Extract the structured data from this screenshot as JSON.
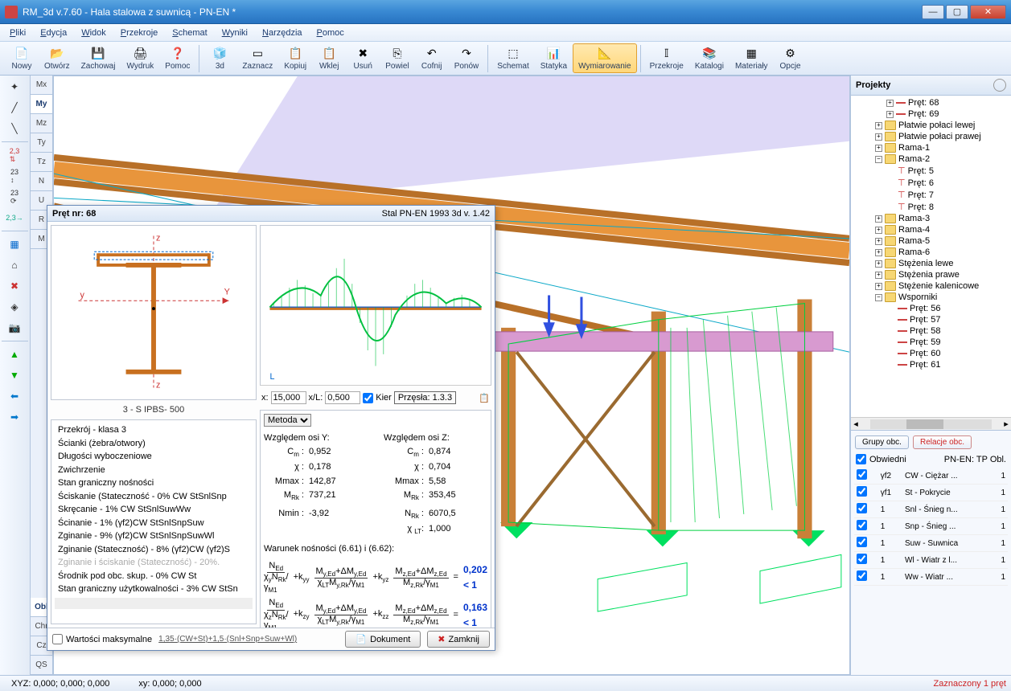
{
  "window": {
    "title": "RM_3d v.7.60 - Hala stalowa z suwnicą - PN-EN *"
  },
  "menu": [
    "Pliki",
    "Edycja",
    "Widok",
    "Przekroje",
    "Schemat",
    "Wyniki",
    "Narzędzia",
    "Pomoc"
  ],
  "toolbar": [
    {
      "label": "Nowy",
      "icon": "📄"
    },
    {
      "label": "Otwórz",
      "icon": "📂"
    },
    {
      "label": "Zachowaj",
      "icon": "💾"
    },
    {
      "label": "Wydruk",
      "icon": "🖨"
    },
    {
      "label": "Pomoc",
      "icon": "❓"
    },
    {
      "sep": true
    },
    {
      "label": "3d",
      "icon": "🧊"
    },
    {
      "label": "Zaznacz",
      "icon": "▭"
    },
    {
      "label": "Kopiuj",
      "icon": "📋"
    },
    {
      "label": "Wklej",
      "icon": "📋"
    },
    {
      "label": "Usuń",
      "icon": "✖"
    },
    {
      "label": "Powiel",
      "icon": "⎘"
    },
    {
      "label": "Cofnij",
      "icon": "↶"
    },
    {
      "label": "Ponów",
      "icon": "↷"
    },
    {
      "sep": true
    },
    {
      "label": "Schemat",
      "icon": "⬚"
    },
    {
      "label": "Statyka",
      "icon": "📊"
    },
    {
      "label": "Wymiarowanie",
      "icon": "📐",
      "active": true
    },
    {
      "sep": true
    },
    {
      "label": "Przekroje",
      "icon": "𝕀"
    },
    {
      "label": "Katalogi",
      "icon": "📚"
    },
    {
      "label": "Materiały",
      "icon": "▦"
    },
    {
      "label": "Opcje",
      "icon": "⚙"
    }
  ],
  "leftTabsTop": [
    "Mx",
    "My",
    "Mz",
    "Ty",
    "Tz",
    "N",
    "U",
    "R",
    "M"
  ],
  "leftTabsBot": [
    "Obl",
    "Chr",
    "Cz",
    "QS"
  ],
  "projects": {
    "title": "Projekty",
    "items": [
      {
        "d": 3,
        "exp": "▷",
        "bar": true,
        "label": "Pręt: 68"
      },
      {
        "d": 3,
        "exp": "▷",
        "bar": true,
        "label": "Pręt: 69"
      },
      {
        "d": 2,
        "exp": "▷",
        "folder": true,
        "label": "Płatwie połaci lewej"
      },
      {
        "d": 2,
        "exp": "▷",
        "folder": true,
        "label": "Płatwie połaci prawej"
      },
      {
        "d": 2,
        "exp": "▷",
        "folder": true,
        "label": "Rama-1"
      },
      {
        "d": 2,
        "exp": "▿",
        "folder": true,
        "label": "Rama-2"
      },
      {
        "d": 3,
        "tee": true,
        "label": "Pręt: 5"
      },
      {
        "d": 3,
        "tee": true,
        "label": "Pręt: 6"
      },
      {
        "d": 3,
        "tee": true,
        "label": "Pręt: 7"
      },
      {
        "d": 3,
        "tee": true,
        "label": "Pręt: 8"
      },
      {
        "d": 2,
        "exp": "▷",
        "folder": true,
        "label": "Rama-3"
      },
      {
        "d": 2,
        "exp": "▷",
        "folder": true,
        "label": "Rama-4"
      },
      {
        "d": 2,
        "exp": "▷",
        "folder": true,
        "label": "Rama-5"
      },
      {
        "d": 2,
        "exp": "▷",
        "folder": true,
        "label": "Rama-6"
      },
      {
        "d": 2,
        "exp": "▷",
        "folder": true,
        "label": "Stężenia lewe"
      },
      {
        "d": 2,
        "exp": "▷",
        "folder": true,
        "label": "Stężenia prawe"
      },
      {
        "d": 2,
        "exp": "▷",
        "folder": true,
        "label": "Stężenie kalenicowe"
      },
      {
        "d": 2,
        "exp": "▿",
        "folder": true,
        "label": "Wsporniki"
      },
      {
        "d": 3,
        "bar": true,
        "label": "Pręt: 56"
      },
      {
        "d": 3,
        "bar": true,
        "label": "Pręt: 57"
      },
      {
        "d": 3,
        "bar": true,
        "label": "Pręt: 58"
      },
      {
        "d": 3,
        "bar": true,
        "label": "Pręt: 59"
      },
      {
        "d": 3,
        "bar": true,
        "label": "Pręt: 60"
      },
      {
        "d": 3,
        "bar": true,
        "label": "Pręt: 61"
      }
    ]
  },
  "groups": {
    "btn1": "Grupy obc.",
    "btn2": "Relacje obc.",
    "chk": "Obwiedni",
    "norm": "PN-EN: TP Obl.",
    "rows": [
      {
        "c": "γf2",
        "desc": "CW - Ciężar ...",
        "n": "1"
      },
      {
        "c": "γf1",
        "desc": "St - Pokrycie",
        "n": "1"
      },
      {
        "c": "1",
        "desc": "Snl - Śnieg n...",
        "n": "1"
      },
      {
        "c": "1",
        "desc": "Snp - Śnieg ...",
        "n": "1"
      },
      {
        "c": "1",
        "desc": "Suw - Suwnica",
        "n": "1"
      },
      {
        "c": "1",
        "desc": "Wl - Wiatr z l...",
        "n": "1"
      },
      {
        "c": "1",
        "desc": "Ww - Wiatr ...",
        "n": "1"
      }
    ]
  },
  "dialog": {
    "titleL": "Pręt nr:  68",
    "titleR": "Stal PN-EN 1993 3d v. 1.42",
    "sectionName": "3 - S IPBS- 500",
    "xVal": "15,000",
    "xlVal": "0,500",
    "kier": "Kier",
    "przesla": "Przęsła: 1.3.3",
    "method": "Metoda",
    "axisY": "Względem osi Y:",
    "axisZ": "Względem osi Z:",
    "valsY": {
      "Cm": "0,952",
      "chi": "0,178",
      "Mmax": "142,87",
      "MRk": "737,21"
    },
    "valsZ": {
      "Cm": "0,874",
      "chi": "0,704",
      "Mmax": "5,58",
      "MRk": "353,45"
    },
    "Nmin": "-3,92",
    "NRk": "6070,5",
    "chiLT": "1,000",
    "condLabel": "Warunek nośności (6.61) i (6.62):",
    "res1": "0,202 < 1",
    "res2": "0,163 < 1",
    "resultLines": [
      "Przekrój - klasa 3",
      "Ścianki (żebra/otwory)",
      "Długości wyboczeniowe",
      "Zwichrzenie",
      "Stan graniczny nośności",
      "    Ściskanie (Stateczność - 0%    CW StSnlSnp",
      "    Skręcanie - 1%    CW StSnlSuwWw",
      "    Ścinanie - 1%    (γf2)CW StSnlSnpSuw",
      "    Zginanie - 9%    (γf2)CW StSnlSnpSuwWl",
      "    Zginanie (Stateczność) - 8%    (γf2)CW (γf2)S",
      "    Zginanie i ściskanie (Stateczność) - 20%.",
      "    Środnik pod obc. skup. - 0%    CW St",
      "Stan graniczny użytkowalności - 3%    CW StSn"
    ],
    "resultDimIdx": 10,
    "chkMax": "Wartości maksymalne",
    "expr": "1,35·(CW+St)+1,5·(Snl+Snp+Suw+Wl)",
    "btnDoc": "Dokument",
    "btnClose": "Zamknij"
  },
  "status": {
    "xyz": "XYZ: 0,000; 0,000; 0,000",
    "xy": "xy: 0,000; 0,000",
    "sel": "Zaznaczony 1 pręt"
  }
}
